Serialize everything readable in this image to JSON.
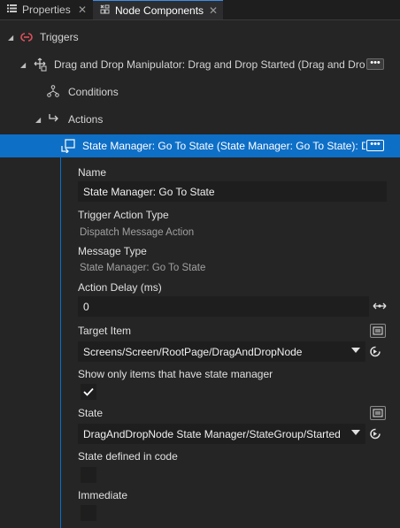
{
  "tabs": [
    {
      "label": "Properties",
      "icon": "list-icon",
      "close": "✕"
    },
    {
      "label": "Node Components",
      "icon": "node-components-icon",
      "close": "✕"
    }
  ],
  "tree": {
    "triggers_label": "Triggers",
    "manipulator_label": "Drag and Drop Manipulator: Drag and Drop Started (Drag and Dro",
    "conditions_label": "Conditions",
    "actions_label": "Actions",
    "selected_label": "State Manager: Go To State (State Manager: Go To State): Dra",
    "more_label": "•••"
  },
  "props": {
    "name_label": "Name",
    "name_value": "State Manager: Go To State",
    "trigger_action_type_label": "Trigger Action Type",
    "trigger_action_type_value": "Dispatch Message Action",
    "message_type_label": "Message Type",
    "message_type_value": "State Manager: Go To State",
    "action_delay_label": "Action Delay (ms)",
    "action_delay_value": "0",
    "target_item_label": "Target Item",
    "target_item_value": "Screens/Screen/RootPage/DragAndDropNode",
    "show_only_label": "Show only items that have state manager",
    "show_only_checked": true,
    "state_label": "State",
    "state_value": "DragAndDropNode State Manager/StateGroup/Started",
    "state_defined_in_code_label": "State defined in code",
    "state_defined_in_code_checked": false,
    "immediate_label": "Immediate",
    "immediate_checked": false
  },
  "colors": {
    "accent": "#0e6fc7",
    "trigger_icon": "#e0505a",
    "background": "#252526",
    "field": "#1e1e1e"
  }
}
